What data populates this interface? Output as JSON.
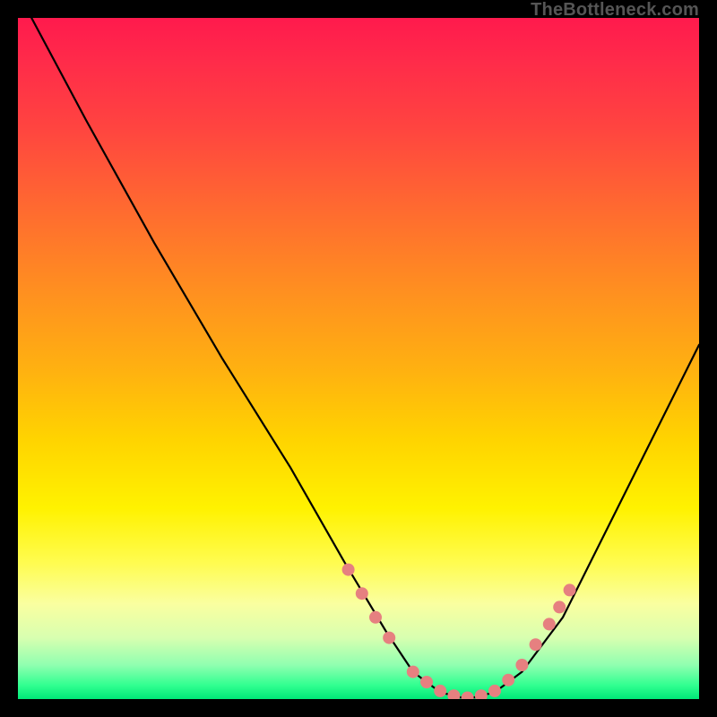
{
  "watermark": "TheBottleneck.com",
  "chart_data": {
    "type": "line",
    "title": "",
    "xlabel": "",
    "ylabel": "",
    "xlim": [
      0,
      100
    ],
    "ylim": [
      0,
      100
    ],
    "series": [
      {
        "name": "bottleneck-curve",
        "x": [
          2,
          10,
          20,
          30,
          40,
          48,
          54,
          58,
          62,
          66,
          70,
          74,
          80,
          88,
          96,
          100
        ],
        "y": [
          100,
          85,
          67,
          50,
          34,
          20,
          10,
          4,
          1,
          0,
          1,
          4,
          12,
          28,
          44,
          52
        ]
      }
    ],
    "markers": {
      "name": "highlight-dots",
      "color": "#e68080",
      "x": [
        48.5,
        50.5,
        52.5,
        54.5,
        58,
        60,
        62,
        64,
        66,
        68,
        70,
        72,
        74,
        76,
        78,
        79.5,
        81
      ],
      "y": [
        19,
        15.5,
        12,
        9,
        4,
        2.5,
        1.2,
        0.5,
        0.2,
        0.5,
        1.2,
        2.8,
        5,
        8,
        11,
        13.5,
        16
      ]
    }
  }
}
